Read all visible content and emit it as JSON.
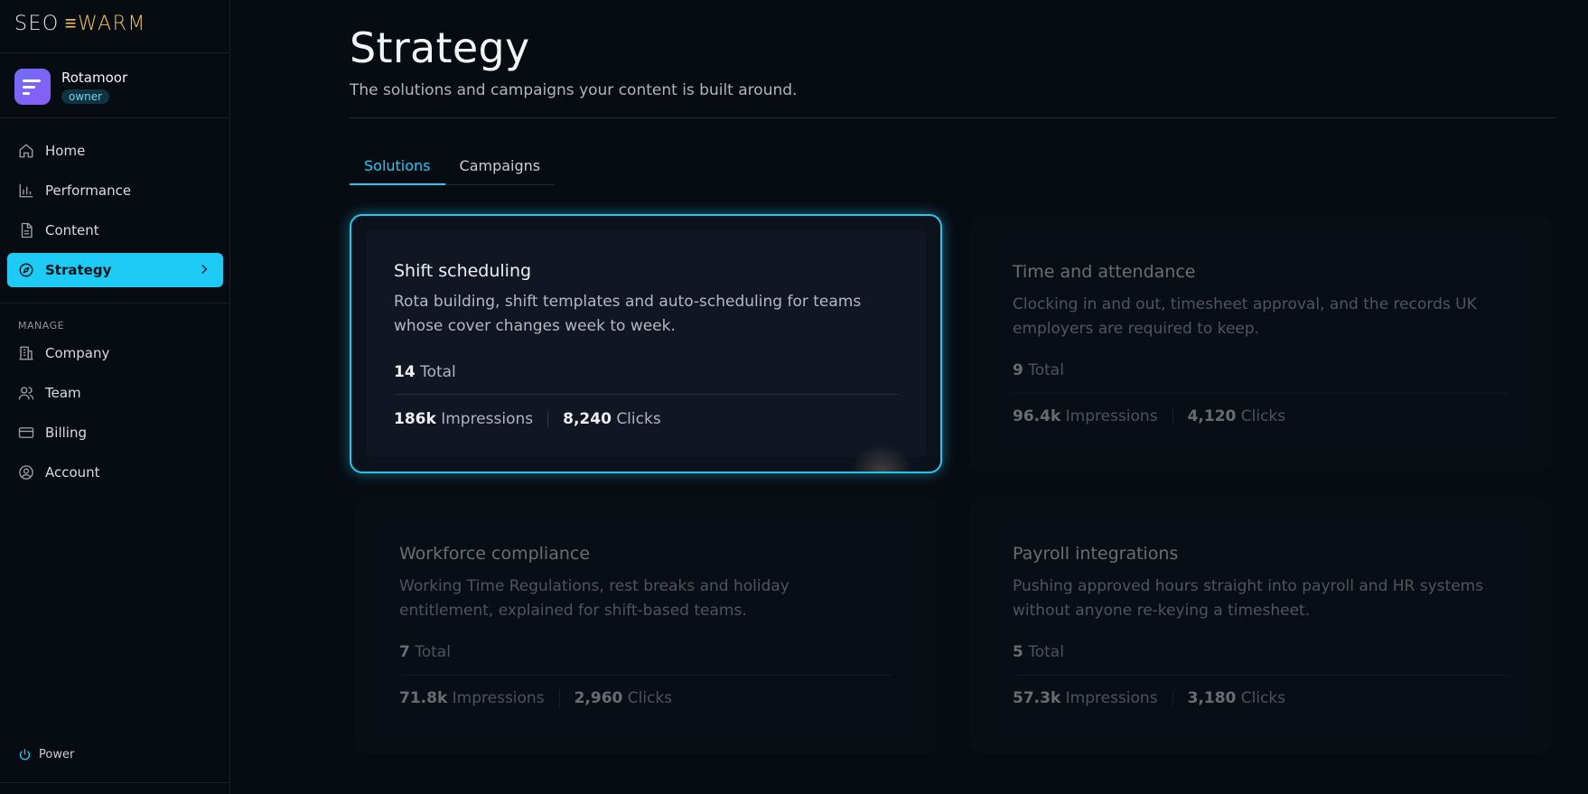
{
  "brand": {
    "seo": "SEO",
    "swarm": "≡WARM"
  },
  "org": {
    "name": "Rotamoor",
    "role": "owner"
  },
  "nav": {
    "home": "Home",
    "performance": "Performance",
    "content": "Content",
    "strategy": "Strategy",
    "manage_label": "MANAGE",
    "company": "Company",
    "team": "Team",
    "billing": "Billing",
    "account": "Account",
    "power": "Power"
  },
  "page": {
    "title": "Strategy",
    "subtitle": "The solutions and campaigns your content is built around."
  },
  "tabs": [
    {
      "label": "Solutions",
      "active": true
    },
    {
      "label": "Campaigns",
      "active": false
    }
  ],
  "solutions": [
    {
      "title": "Shift scheduling",
      "description": "Rota building, shift templates and auto-scheduling for teams whose cover changes week to week.",
      "total": "14",
      "total_label": "Total",
      "impressions": "186k",
      "impressions_label": "Impressions",
      "clicks": "8,240",
      "clicks_label": "Clicks",
      "active": true
    },
    {
      "title": "Time and attendance",
      "description": "Clocking in and out, timesheet approval, and the records UK employers are required to keep.",
      "total": "9",
      "total_label": "Total",
      "impressions": "96.4k",
      "impressions_label": "Impressions",
      "clicks": "4,120",
      "clicks_label": "Clicks",
      "active": false
    },
    {
      "title": "Workforce compliance",
      "description": "Working Time Regulations, rest breaks and holiday entitlement, explained for shift-based teams.",
      "total": "7",
      "total_label": "Total",
      "impressions": "71.8k",
      "impressions_label": "Impressions",
      "clicks": "2,960",
      "clicks_label": "Clicks",
      "active": false
    },
    {
      "title": "Payroll integrations",
      "description": "Pushing approved hours straight into payroll and HR systems without anyone re-keying a timesheet.",
      "total": "5",
      "total_label": "Total",
      "impressions": "57.3k",
      "impressions_label": "Impressions",
      "clicks": "3,180",
      "clicks_label": "Clicks",
      "active": false
    }
  ],
  "colors": {
    "accent": "#1ecbf5",
    "brand_gold": "#f4c04a",
    "background": "#070b12"
  }
}
